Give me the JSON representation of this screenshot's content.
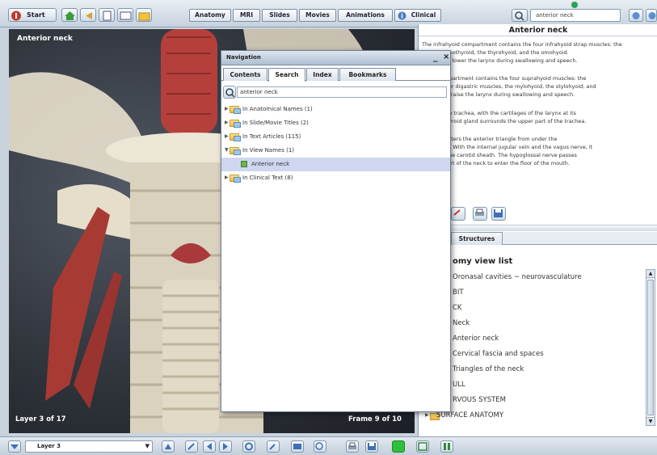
{
  "toolbar": {
    "start_label": "Start",
    "tabs": [
      "Anatomy",
      "MRI",
      "Slides",
      "Movies",
      "Animations",
      "Clinical"
    ],
    "search_value": "anterior neck"
  },
  "view": {
    "title": "Anterior neck",
    "layer_text": "Layer 3 of 17",
    "frame_text": "Frame 9 of 10"
  },
  "navigation": {
    "title": "Navigation",
    "minimize": "_",
    "close": "×",
    "tabs": [
      "Contents",
      "Search",
      "Index",
      "Bookmarks"
    ],
    "active_tab": "Search",
    "search_value": "anterior neck",
    "tree": [
      {
        "label": "In Anatomical Names (1)",
        "expanded": false
      },
      {
        "label": "In Slide/Movie Titles (2)",
        "expanded": false
      },
      {
        "label": "In Text Articles (115)",
        "expanded": false
      },
      {
        "label": "In View Names (1)",
        "expanded": true
      },
      {
        "label": "Anterior neck",
        "child": true,
        "selected": true
      },
      {
        "label": "In Clinical Text (8)",
        "expanded": false
      }
    ]
  },
  "article": {
    "title": "Anterior neck",
    "paragraphs": [
      "The infrahyoid compartment contains the four infrahyoid strap muscles: the\nd, the sternothyroid, the thyrohyoid, and the omohyoid.\nthey act to lower the larynx during swallowing and speech.",
      "hyoid compartment contains the four suprahyoid muscles: the\nnd posterior digastric muscles, the mylohyoid, the stylohyoid, and\nyoid. They raise the larynx during swallowing and speech.",
      "line lies the trachea, with the cartilages of the larynx at its\nnd. The thyroid gland surrounds the upper part of the trachea.",
      "d artery enters the anterior triangle from under the\ndomastoid. With the internal jugular vein and the vagus nerve, it\nctures of the carotid sheath. The hypoglossal nerve passes\ne upper part of the neck to enter the floor of the mouth."
    ]
  },
  "list_panel": {
    "tabs": [
      "Structures"
    ],
    "heading": "omy view list",
    "items": [
      "Oronasal cavities ~ neurovasculature",
      "BIT",
      "CK",
      "Neck",
      "Anterior neck",
      "Cervical fascia and spaces",
      "Triangles of the neck",
      "ULL",
      "RVOUS SYSTEM",
      "SURFACE ANATOMY"
    ]
  },
  "bottom": {
    "layer_select": "Layer 3"
  }
}
